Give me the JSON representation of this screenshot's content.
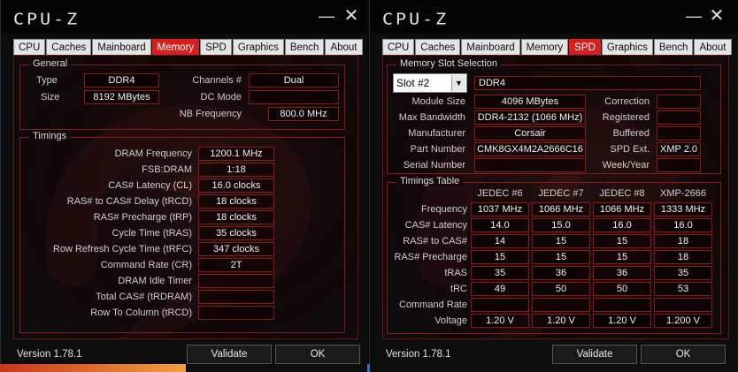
{
  "app": {
    "logo": "CPU-Z",
    "minimize_glyph": "—",
    "close_glyph": "✕",
    "version": "Version 1.78.1",
    "validate_label": "Validate",
    "ok_label": "OK"
  },
  "tabs": [
    "CPU",
    "Caches",
    "Mainboard",
    "Memory",
    "SPD",
    "Graphics",
    "Bench",
    "About"
  ],
  "memory": {
    "general": {
      "title": "General",
      "type_label": "Type",
      "type_value": "DDR4",
      "size_label": "Size",
      "size_value": "8192 MBytes",
      "channels_label": "Channels #",
      "channels_value": "Dual",
      "dc_mode_label": "DC Mode",
      "dc_mode_value": "",
      "nb_freq_label": "NB Frequency",
      "nb_freq_value": "800.0 MHz"
    },
    "timings": {
      "title": "Timings",
      "rows": [
        {
          "label": "DRAM Frequency",
          "value": "1200.1 MHz"
        },
        {
          "label": "FSB:DRAM",
          "value": "1:18"
        },
        {
          "label": "CAS# Latency (CL)",
          "value": "16.0 clocks"
        },
        {
          "label": "RAS# to CAS# Delay (tRCD)",
          "value": "18 clocks"
        },
        {
          "label": "RAS# Precharge (tRP)",
          "value": "18 clocks"
        },
        {
          "label": "Cycle Time (tRAS)",
          "value": "35 clocks"
        },
        {
          "label": "Row Refresh Cycle Time (tRFC)",
          "value": "347 clocks"
        },
        {
          "label": "Command Rate (CR)",
          "value": "2T"
        },
        {
          "label": "DRAM Idle Timer",
          "value": ""
        },
        {
          "label": "Total CAS# (tRDRAM)",
          "value": ""
        },
        {
          "label": "Row To Column (tRCD)",
          "value": ""
        }
      ]
    }
  },
  "spd": {
    "slot_group_title": "Memory Slot Selection",
    "slot_selected": "Slot #2",
    "slot_type": "DDR4",
    "module_size_label": "Module Size",
    "module_size_value": "4096 MBytes",
    "max_bw_label": "Max Bandwidth",
    "max_bw_value": "DDR4-2132 (1066 MHz)",
    "manufacturer_label": "Manufacturer",
    "manufacturer_value": "Corsair",
    "part_label": "Part Number",
    "part_value": "CMK8GX4M2A2666C16",
    "serial_label": "Serial Number",
    "serial_value": "",
    "correction_label": "Correction",
    "correction_value": "",
    "registered_label": "Registered",
    "registered_value": "",
    "buffered_label": "Buffered",
    "buffered_value": "",
    "spd_ext_label": "SPD Ext.",
    "spd_ext_value": "XMP 2.0",
    "week_year_label": "Week/Year",
    "week_year_value": "",
    "timings_table": {
      "title": "Timings Table",
      "columns": [
        "JEDEC #6",
        "JEDEC #7",
        "JEDEC #8",
        "XMP-2666"
      ],
      "rows": [
        {
          "label": "Frequency",
          "values": [
            "1037 MHz",
            "1066 MHz",
            "1066 MHz",
            "1333 MHz"
          ]
        },
        {
          "label": "CAS# Latency",
          "values": [
            "14.0",
            "15.0",
            "16.0",
            "16.0"
          ]
        },
        {
          "label": "RAS# to CAS#",
          "values": [
            "14",
            "15",
            "15",
            "18"
          ]
        },
        {
          "label": "RAS# Precharge",
          "values": [
            "15",
            "15",
            "15",
            "18"
          ]
        },
        {
          "label": "tRAS",
          "values": [
            "35",
            "36",
            "36",
            "35"
          ]
        },
        {
          "label": "tRC",
          "values": [
            "49",
            "50",
            "50",
            "53"
          ]
        },
        {
          "label": "Command Rate",
          "values": [
            "",
            "",
            "",
            ""
          ]
        },
        {
          "label": "Voltage",
          "values": [
            "1.20 V",
            "1.20 V",
            "1.20 V",
            "1.200 V"
          ]
        }
      ]
    }
  },
  "colors": {
    "accent": "#d42020",
    "border": "#8a1a1a",
    "bg": "#0d0d0d"
  }
}
